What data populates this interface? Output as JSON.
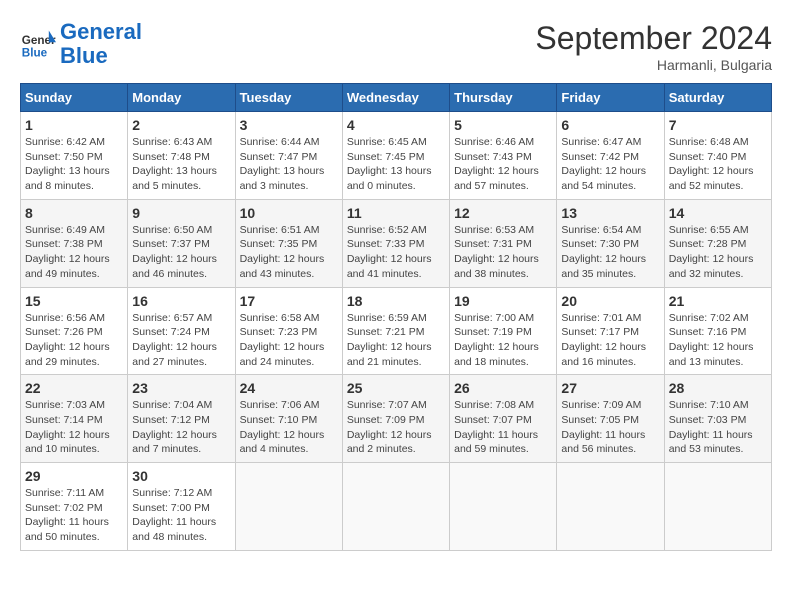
{
  "header": {
    "logo_line1": "General",
    "logo_line2": "Blue",
    "month": "September 2024",
    "location": "Harmanli, Bulgaria"
  },
  "weekdays": [
    "Sunday",
    "Monday",
    "Tuesday",
    "Wednesday",
    "Thursday",
    "Friday",
    "Saturday"
  ],
  "weeks": [
    [
      {
        "day": "1",
        "info": "Sunrise: 6:42 AM\nSunset: 7:50 PM\nDaylight: 13 hours\nand 8 minutes."
      },
      {
        "day": "2",
        "info": "Sunrise: 6:43 AM\nSunset: 7:48 PM\nDaylight: 13 hours\nand 5 minutes."
      },
      {
        "day": "3",
        "info": "Sunrise: 6:44 AM\nSunset: 7:47 PM\nDaylight: 13 hours\nand 3 minutes."
      },
      {
        "day": "4",
        "info": "Sunrise: 6:45 AM\nSunset: 7:45 PM\nDaylight: 13 hours\nand 0 minutes."
      },
      {
        "day": "5",
        "info": "Sunrise: 6:46 AM\nSunset: 7:43 PM\nDaylight: 12 hours\nand 57 minutes."
      },
      {
        "day": "6",
        "info": "Sunrise: 6:47 AM\nSunset: 7:42 PM\nDaylight: 12 hours\nand 54 minutes."
      },
      {
        "day": "7",
        "info": "Sunrise: 6:48 AM\nSunset: 7:40 PM\nDaylight: 12 hours\nand 52 minutes."
      }
    ],
    [
      {
        "day": "8",
        "info": "Sunrise: 6:49 AM\nSunset: 7:38 PM\nDaylight: 12 hours\nand 49 minutes."
      },
      {
        "day": "9",
        "info": "Sunrise: 6:50 AM\nSunset: 7:37 PM\nDaylight: 12 hours\nand 46 minutes."
      },
      {
        "day": "10",
        "info": "Sunrise: 6:51 AM\nSunset: 7:35 PM\nDaylight: 12 hours\nand 43 minutes."
      },
      {
        "day": "11",
        "info": "Sunrise: 6:52 AM\nSunset: 7:33 PM\nDaylight: 12 hours\nand 41 minutes."
      },
      {
        "day": "12",
        "info": "Sunrise: 6:53 AM\nSunset: 7:31 PM\nDaylight: 12 hours\nand 38 minutes."
      },
      {
        "day": "13",
        "info": "Sunrise: 6:54 AM\nSunset: 7:30 PM\nDaylight: 12 hours\nand 35 minutes."
      },
      {
        "day": "14",
        "info": "Sunrise: 6:55 AM\nSunset: 7:28 PM\nDaylight: 12 hours\nand 32 minutes."
      }
    ],
    [
      {
        "day": "15",
        "info": "Sunrise: 6:56 AM\nSunset: 7:26 PM\nDaylight: 12 hours\nand 29 minutes."
      },
      {
        "day": "16",
        "info": "Sunrise: 6:57 AM\nSunset: 7:24 PM\nDaylight: 12 hours\nand 27 minutes."
      },
      {
        "day": "17",
        "info": "Sunrise: 6:58 AM\nSunset: 7:23 PM\nDaylight: 12 hours\nand 24 minutes."
      },
      {
        "day": "18",
        "info": "Sunrise: 6:59 AM\nSunset: 7:21 PM\nDaylight: 12 hours\nand 21 minutes."
      },
      {
        "day": "19",
        "info": "Sunrise: 7:00 AM\nSunset: 7:19 PM\nDaylight: 12 hours\nand 18 minutes."
      },
      {
        "day": "20",
        "info": "Sunrise: 7:01 AM\nSunset: 7:17 PM\nDaylight: 12 hours\nand 16 minutes."
      },
      {
        "day": "21",
        "info": "Sunrise: 7:02 AM\nSunset: 7:16 PM\nDaylight: 12 hours\nand 13 minutes."
      }
    ],
    [
      {
        "day": "22",
        "info": "Sunrise: 7:03 AM\nSunset: 7:14 PM\nDaylight: 12 hours\nand 10 minutes."
      },
      {
        "day": "23",
        "info": "Sunrise: 7:04 AM\nSunset: 7:12 PM\nDaylight: 12 hours\nand 7 minutes."
      },
      {
        "day": "24",
        "info": "Sunrise: 7:06 AM\nSunset: 7:10 PM\nDaylight: 12 hours\nand 4 minutes."
      },
      {
        "day": "25",
        "info": "Sunrise: 7:07 AM\nSunset: 7:09 PM\nDaylight: 12 hours\nand 2 minutes."
      },
      {
        "day": "26",
        "info": "Sunrise: 7:08 AM\nSunset: 7:07 PM\nDaylight: 11 hours\nand 59 minutes."
      },
      {
        "day": "27",
        "info": "Sunrise: 7:09 AM\nSunset: 7:05 PM\nDaylight: 11 hours\nand 56 minutes."
      },
      {
        "day": "28",
        "info": "Sunrise: 7:10 AM\nSunset: 7:03 PM\nDaylight: 11 hours\nand 53 minutes."
      }
    ],
    [
      {
        "day": "29",
        "info": "Sunrise: 7:11 AM\nSunset: 7:02 PM\nDaylight: 11 hours\nand 50 minutes."
      },
      {
        "day": "30",
        "info": "Sunrise: 7:12 AM\nSunset: 7:00 PM\nDaylight: 11 hours\nand 48 minutes."
      },
      {
        "day": "",
        "info": ""
      },
      {
        "day": "",
        "info": ""
      },
      {
        "day": "",
        "info": ""
      },
      {
        "day": "",
        "info": ""
      },
      {
        "day": "",
        "info": ""
      }
    ]
  ]
}
